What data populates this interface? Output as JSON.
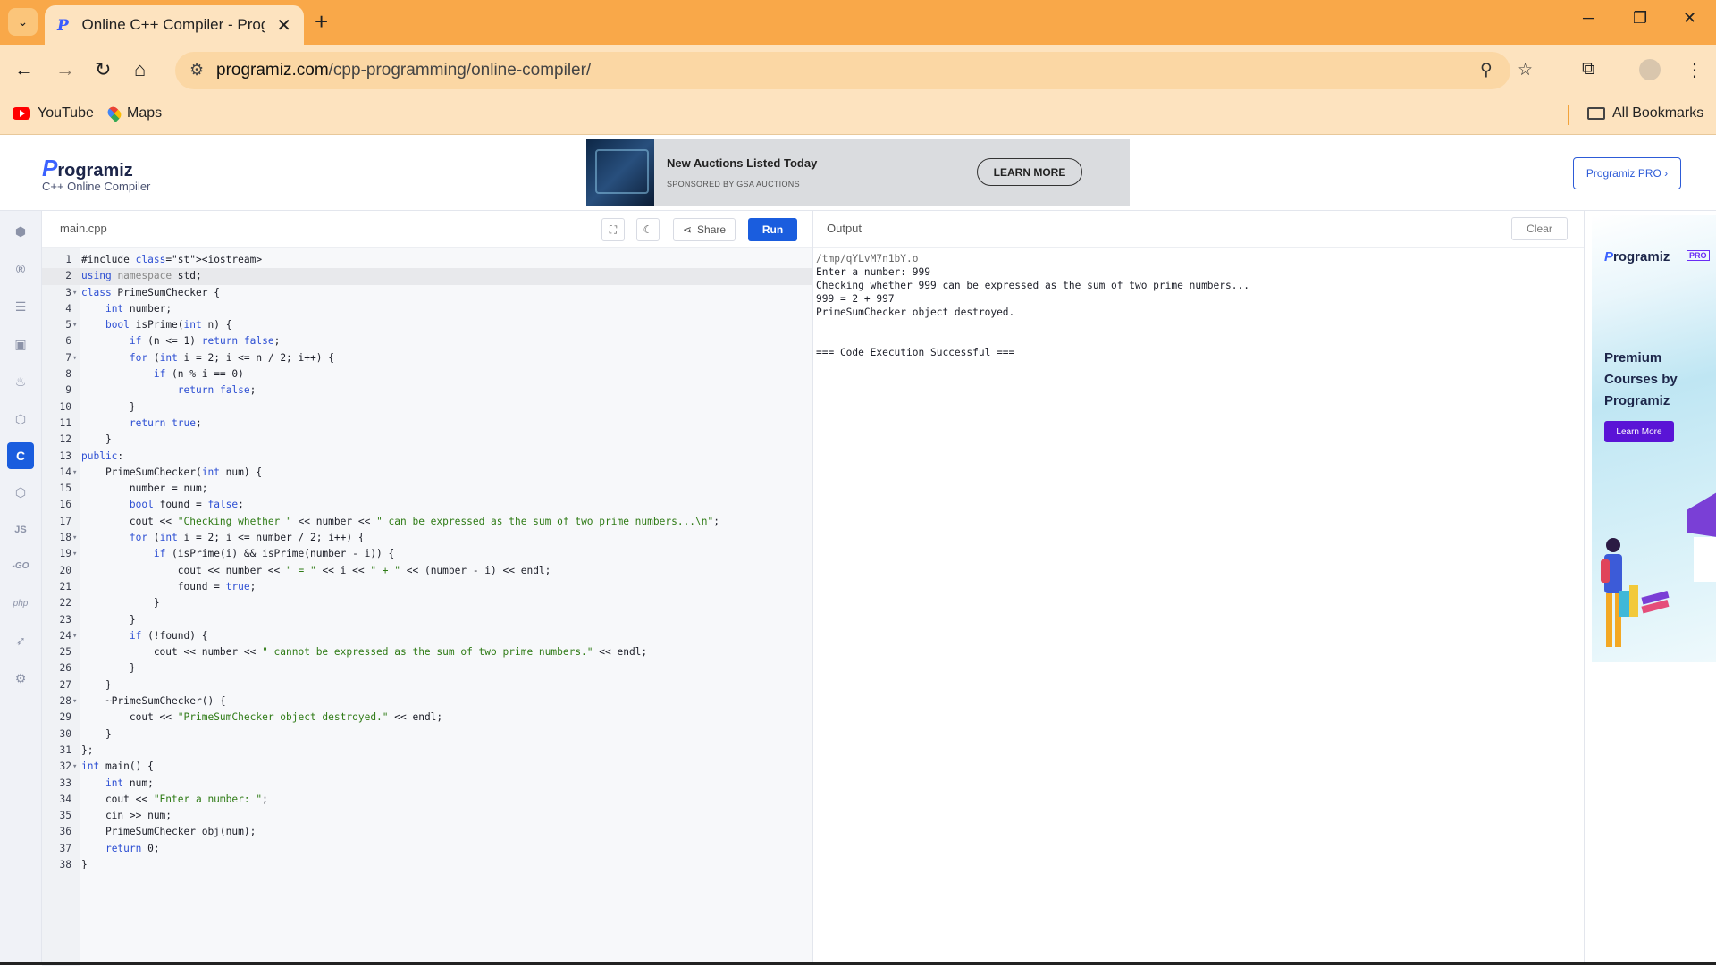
{
  "browser": {
    "tab_title": "Online C++ Compiler - Programiz",
    "url_host": "programiz.com",
    "url_path": "/cpp-programming/online-compiler/",
    "bookmarks": [
      "YouTube",
      "Maps"
    ],
    "all_bookmarks": "All Bookmarks"
  },
  "header": {
    "logo": "rogramiz",
    "logo_p": "P",
    "subtitle": "C++ Online Compiler",
    "pro_button": "Programiz PRO ›",
    "ad": {
      "title": "New Auctions Listed Today",
      "sponsor": "SPONSORED BY GSA AUCTIONS",
      "button": "LEARN MORE"
    }
  },
  "sidebar": {
    "languages": [
      "python",
      "r",
      "sql",
      "html",
      "java",
      "c",
      "cpp",
      "csharp",
      "js",
      "go",
      "php",
      "swift",
      "rust"
    ],
    "labels": [
      "JS",
      "-GO",
      "php"
    ],
    "active": "cpp"
  },
  "editor": {
    "filename": "main.cpp",
    "share_label": "Share",
    "run_label": "Run",
    "lines": [
      "#include <iostream>",
      "using namespace std;",
      "class PrimeSumChecker {",
      "    int number;",
      "    bool isPrime(int n) {",
      "        if (n <= 1) return false;",
      "        for (int i = 2; i <= n / 2; i++) {",
      "            if (n % i == 0)",
      "                return false;",
      "        }",
      "        return true;",
      "    }",
      "public:",
      "    PrimeSumChecker(int num) {",
      "        number = num;",
      "        bool found = false;",
      "        cout << \"Checking whether \" << number << \" can be expressed as the sum of two prime numbers...\\n\";",
      "        for (int i = 2; i <= number / 2; i++) {",
      "            if (isPrime(i) && isPrime(number - i)) {",
      "                cout << number << \" = \" << i << \" + \" << (number - i) << endl;",
      "                found = true;",
      "            }",
      "        }",
      "        if (!found) {",
      "            cout << number << \" cannot be expressed as the sum of two prime numbers.\" << endl;",
      "        }",
      "    }",
      "    ~PrimeSumChecker() {",
      "        cout << \"PrimeSumChecker object destroyed.\" << endl;",
      "    }",
      "};",
      "int main() {",
      "    int num;",
      "    cout << \"Enter a number: \";",
      "    cin >> num;",
      "    PrimeSumChecker obj(num);",
      "    return 0;",
      "}"
    ],
    "fold_lines": [
      3,
      5,
      7,
      14,
      18,
      19,
      24,
      28,
      32
    ],
    "highlighted_line": 2
  },
  "output": {
    "label": "Output",
    "clear_label": "Clear",
    "lines": [
      "/tmp/qYLvM7n1bY.o",
      "Enter a number: 999",
      "Checking whether 999 can be expressed as the sum of two prime numbers...",
      "999 = 2 + 997",
      "PrimeSumChecker object destroyed.",
      "",
      "",
      "=== Code Execution Successful ==="
    ]
  },
  "right_ad": {
    "logo": "rogramiz",
    "logo_p": "P",
    "pro_badge": "PRO",
    "headline": "Premium Courses by Programiz",
    "button": "Learn More"
  }
}
